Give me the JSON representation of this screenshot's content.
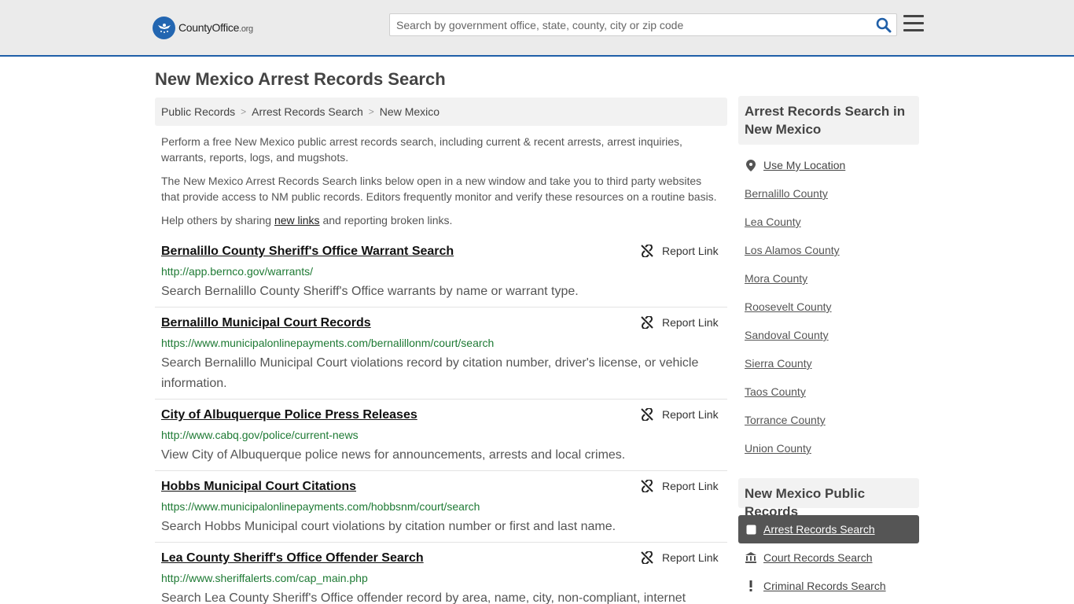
{
  "header": {
    "logo_brand": "CountyOffice",
    "logo_tld": ".org",
    "search_placeholder": "Search by government office, state, county, city or zip code"
  },
  "page_title": "New Mexico Arrest Records Search",
  "breadcrumb": [
    "Public Records",
    "Arrest Records Search",
    "New Mexico"
  ],
  "intro": {
    "p1": "Perform a free New Mexico public arrest records search, including current & recent arrests, arrest inquiries, warrants, reports, logs, and mugshots.",
    "p2": "The New Mexico Arrest Records Search links below open in a new window and take you to third party websites that provide access to NM public records. Editors frequently monitor and verify these resources on a routine basis.",
    "p3_before": "Help others by sharing ",
    "p3_link": "new links",
    "p3_after": " and reporting broken links."
  },
  "report_label": "Report Link",
  "results": [
    {
      "title": "Bernalillo County Sheriff's Office Warrant Search",
      "url": "http://app.bernco.gov/warrants/",
      "desc": "Search Bernalillo County Sheriff's Office warrants by name or warrant type."
    },
    {
      "title": "Bernalillo Municipal Court Records",
      "url": "https://www.municipalonlinepayments.com/bernalillonm/court/search",
      "desc": "Search Bernalillo Municipal Court violations record by citation number, driver's license, or vehicle information."
    },
    {
      "title": "City of Albuquerque Police Press Releases",
      "url": "http://www.cabq.gov/police/current-news",
      "desc": "View City of Albuquerque police news for announcements, arrests and local crimes."
    },
    {
      "title": "Hobbs Municipal Court Citations",
      "url": "https://www.municipalonlinepayments.com/hobbsnm/court/search",
      "desc": "Search Hobbs Municipal court violations by citation number or first and last name."
    },
    {
      "title": "Lea County Sheriff's Office Offender Search",
      "url": "http://www.sheriffalerts.com/cap_main.php",
      "desc": "Search Lea County Sheriff's Office offender record by area, name, city, non-compliant, internet"
    }
  ],
  "sidebar": {
    "heading1": "Arrest Records Search in New Mexico",
    "use_location": "Use My Location",
    "counties": [
      "Bernalillo County",
      "Lea County",
      "Los Alamos County",
      "Mora County",
      "Roosevelt County",
      "Sandoval County",
      "Sierra County",
      "Taos County",
      "Torrance County",
      "Union County"
    ],
    "heading2": "New Mexico Public Records",
    "records": [
      {
        "label": "Arrest Records Search",
        "icon": "square-icon"
      },
      {
        "label": "Court Records Search",
        "icon": "courthouse-icon"
      },
      {
        "label": "Criminal Records Search",
        "icon": "exclamation-icon"
      }
    ]
  },
  "colors": {
    "accent": "#1f5fa8",
    "url_green": "#1e7a34",
    "active_bg": "#555555"
  }
}
